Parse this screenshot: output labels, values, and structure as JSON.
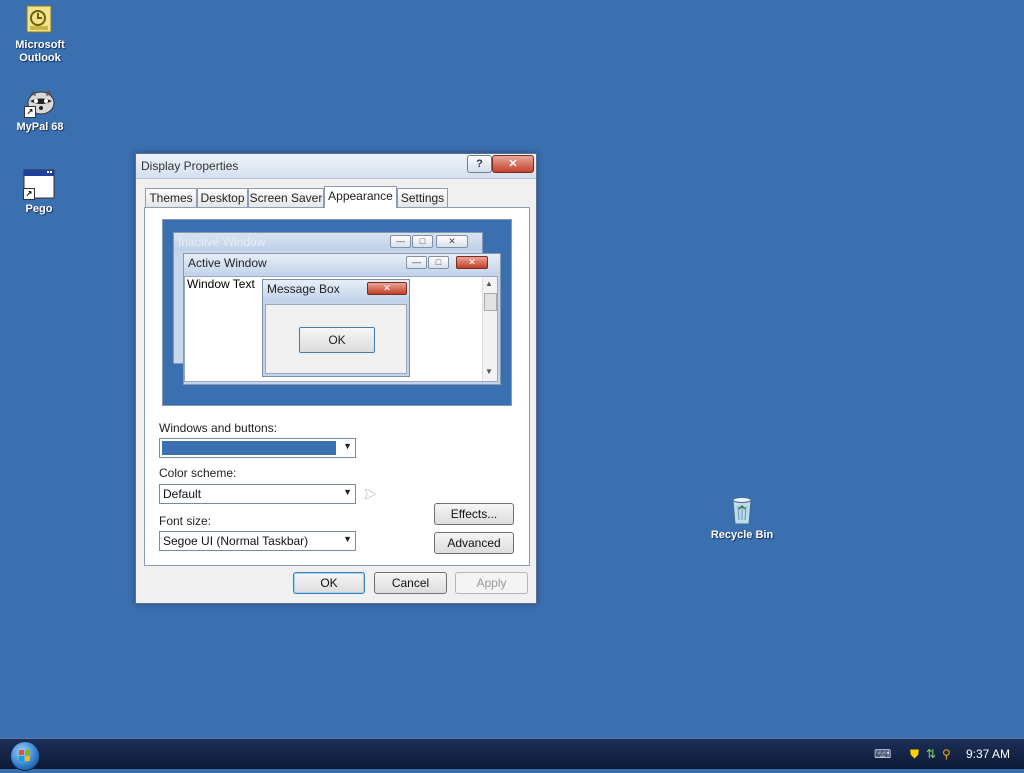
{
  "desktop": {
    "icons": [
      {
        "label_line1": "Microsoft",
        "label_line2": "Outlook",
        "icon": "outlook-icon"
      },
      {
        "label_line1": "MyPal 68",
        "label_line2": "",
        "icon": "raccoon-icon"
      },
      {
        "label_line1": "Pego",
        "label_line2": "",
        "icon": "window-app-icon"
      },
      {
        "label_line1": "Recycle Bin",
        "label_line2": "",
        "icon": "recycle-bin-icon"
      }
    ],
    "background_color": "#3a6fb0"
  },
  "dialog": {
    "title": "Display Properties",
    "help_symbol": "?",
    "close_symbol": "✕",
    "tabs": [
      {
        "label": "Themes",
        "active": false
      },
      {
        "label": "Desktop",
        "active": false
      },
      {
        "label": "Screen Saver",
        "active": false
      },
      {
        "label": "Appearance",
        "active": true
      },
      {
        "label": "Settings",
        "active": false
      }
    ],
    "preview": {
      "inactive_title": "Inactive Window",
      "active_title": "Active Window",
      "window_text": "Window Text",
      "message_box_title": "Message Box",
      "message_box_ok": "OK"
    },
    "windows_and_buttons_label": "Windows and buttons:",
    "windows_and_buttons_value_color": "#3a6fb0",
    "color_scheme_label": "Color scheme:",
    "color_scheme_value": "Default",
    "font_size_label": "Font size:",
    "font_size_value": "Segoe UI (Normal Taskbar)",
    "effects_button": "Effects...",
    "advanced_button": "Advanced",
    "ok_button": "OK",
    "cancel_button": "Cancel",
    "apply_button": "Apply"
  },
  "taskbar": {
    "clock": "9:37 AM"
  }
}
